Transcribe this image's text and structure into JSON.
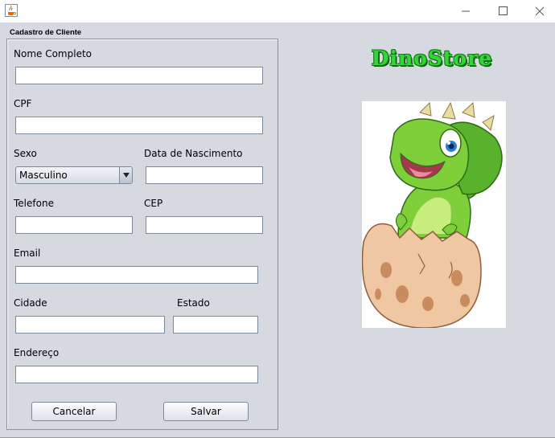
{
  "window": {
    "title": ""
  },
  "form": {
    "panel_title": "Cadastro de Cliente",
    "labels": {
      "nome": "Nome Completo",
      "cpf": "CPF",
      "sexo": "Sexo",
      "nascimento": "Data de Nascimento",
      "telefone": "Telefone",
      "cep": "CEP",
      "email": "Email",
      "cidade": "Cidade",
      "estado": "Estado",
      "endereco": "Endereço"
    },
    "values": {
      "nome": "",
      "cpf": "",
      "nascimento": "",
      "telefone": "",
      "cep": "",
      "email": "",
      "cidade": "",
      "estado": "",
      "endereco": ""
    },
    "sexo_selected": "Masculino",
    "buttons": {
      "cancel": "Cancelar",
      "save": "Salvar"
    }
  },
  "brand": {
    "name": "DinoStore"
  },
  "icons": {
    "app": "java-cup-icon",
    "minimize": "minimize-icon",
    "maximize": "maximize-icon",
    "close": "close-icon",
    "dropdown": "triangle-down-icon"
  },
  "colors": {
    "client_bg": "#d6d9df",
    "brand_green": "#3ad23a",
    "brand_outline": "#0f7d16"
  }
}
